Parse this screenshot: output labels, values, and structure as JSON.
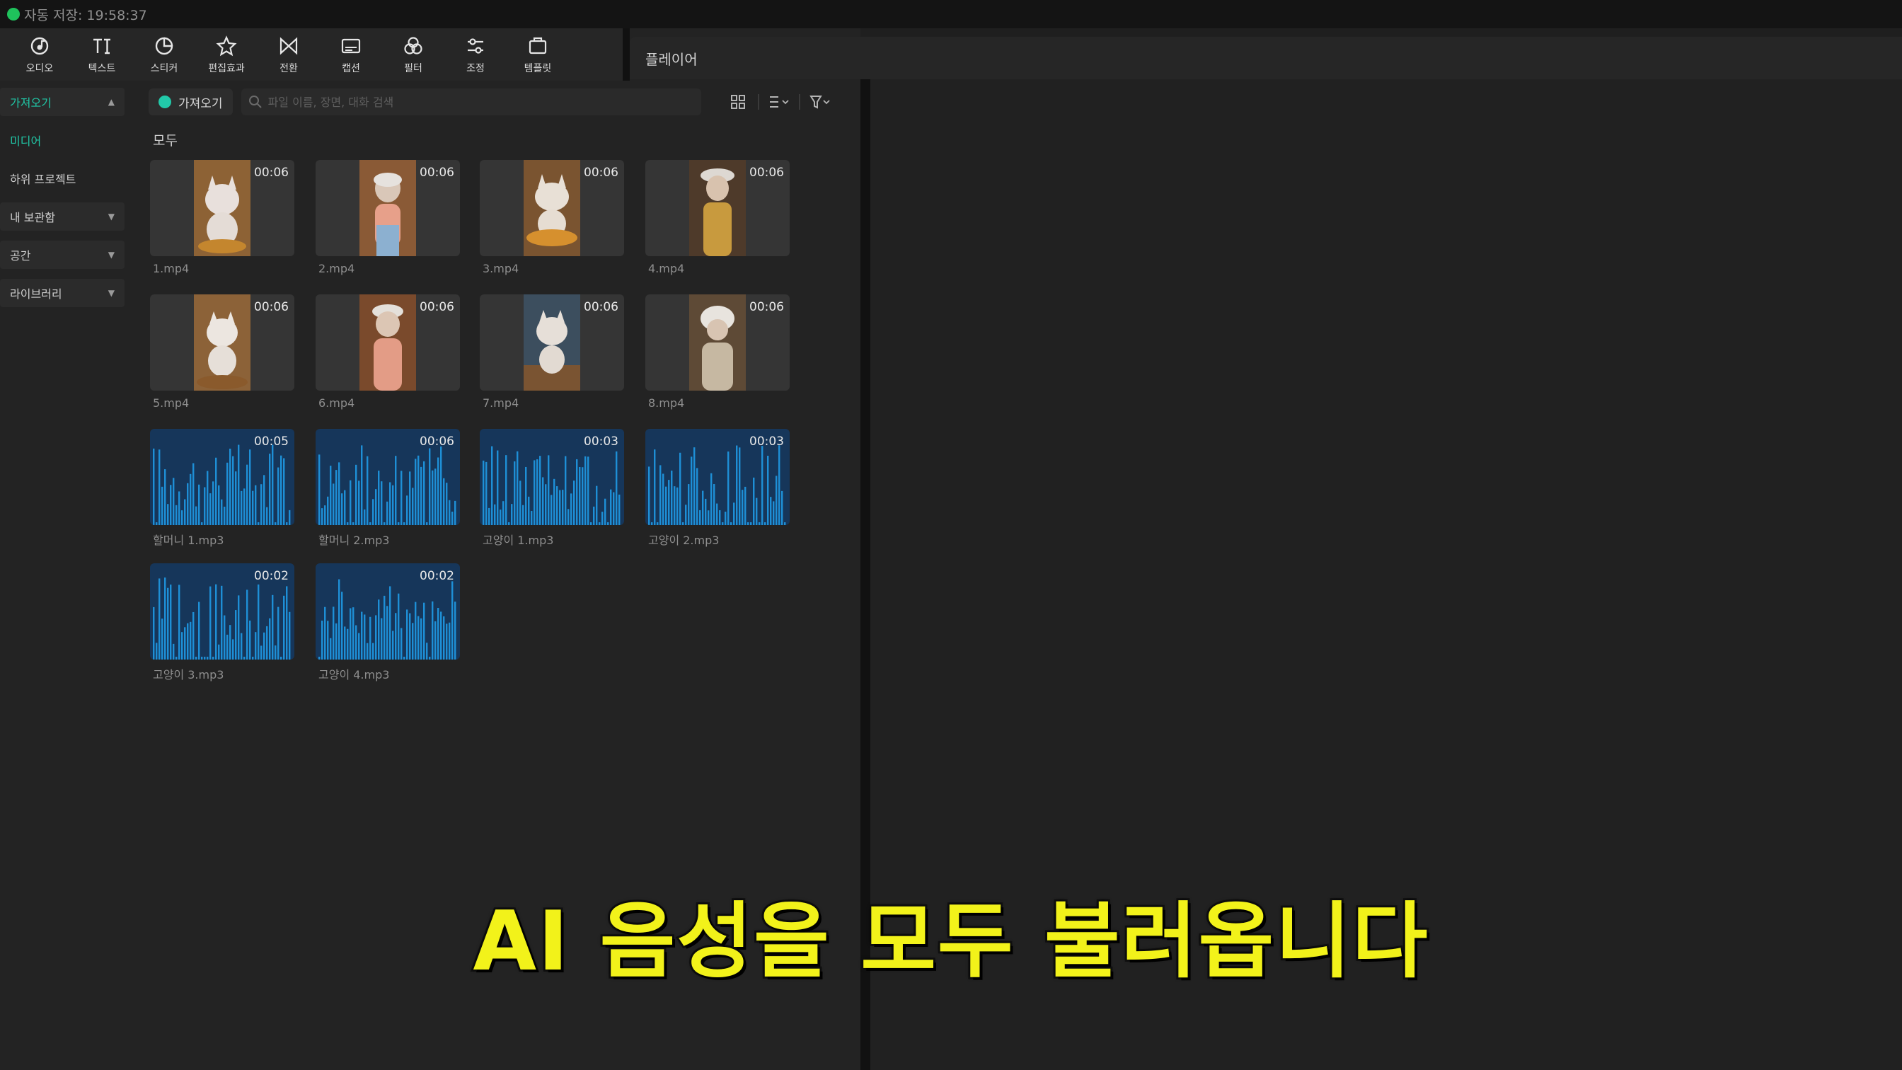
{
  "status": {
    "autosave": "자동 저장: 19:58:37",
    "dot_color": "#1fc25c"
  },
  "toolbar": [
    {
      "label": "오디오",
      "icon": "audio-icon"
    },
    {
      "label": "텍스트",
      "icon": "text-icon"
    },
    {
      "label": "스티커",
      "icon": "sticker-icon"
    },
    {
      "label": "편집효과",
      "icon": "effects-icon"
    },
    {
      "label": "전환",
      "icon": "transition-icon"
    },
    {
      "label": "캡션",
      "icon": "caption-icon"
    },
    {
      "label": "필터",
      "icon": "filter-icon"
    },
    {
      "label": "조정",
      "icon": "adjust-icon"
    },
    {
      "label": "템플릿",
      "icon": "template-icon"
    }
  ],
  "sidenav": {
    "import": "가져오기",
    "media": "미디어",
    "subproject": "하위 프로젝트",
    "mylibrary": "내 보관함",
    "space": "공간",
    "library": "라이브러리"
  },
  "mediahead": {
    "import_label": "가져오기",
    "search_placeholder": "파일 이름, 장면, 대화 검색"
  },
  "section_label": "모두",
  "media": [
    {
      "name": "1.mp4",
      "duration": "00:06",
      "kind": "video"
    },
    {
      "name": "2.mp4",
      "duration": "00:06",
      "kind": "video"
    },
    {
      "name": "3.mp4",
      "duration": "00:06",
      "kind": "video"
    },
    {
      "name": "4.mp4",
      "duration": "00:06",
      "kind": "video"
    },
    {
      "name": "5.mp4",
      "duration": "00:06",
      "kind": "video"
    },
    {
      "name": "6.mp4",
      "duration": "00:06",
      "kind": "video"
    },
    {
      "name": "7.mp4",
      "duration": "00:06",
      "kind": "video"
    },
    {
      "name": "8.mp4",
      "duration": "00:06",
      "kind": "video"
    },
    {
      "name": "할머니 1.mp3",
      "duration": "00:05",
      "kind": "audio"
    },
    {
      "name": "할머니 2.mp3",
      "duration": "00:06",
      "kind": "audio"
    },
    {
      "name": "고양이 1.mp3",
      "duration": "00:03",
      "kind": "audio"
    },
    {
      "name": "고양이 2.mp3",
      "duration": "00:03",
      "kind": "audio"
    },
    {
      "name": "고양이 3.mp3",
      "duration": "00:02",
      "kind": "audio"
    },
    {
      "name": "고양이 4.mp3",
      "duration": "00:02",
      "kind": "audio"
    }
  ],
  "player": {
    "title": "플레이어"
  },
  "subtitle": "AI 음성을 모두 불러옵니다",
  "colors": {
    "accent": "#20c7a6",
    "audio_bg": "#16365a",
    "wave": "#1e8fd6",
    "subtitle": "#f2f21a"
  }
}
